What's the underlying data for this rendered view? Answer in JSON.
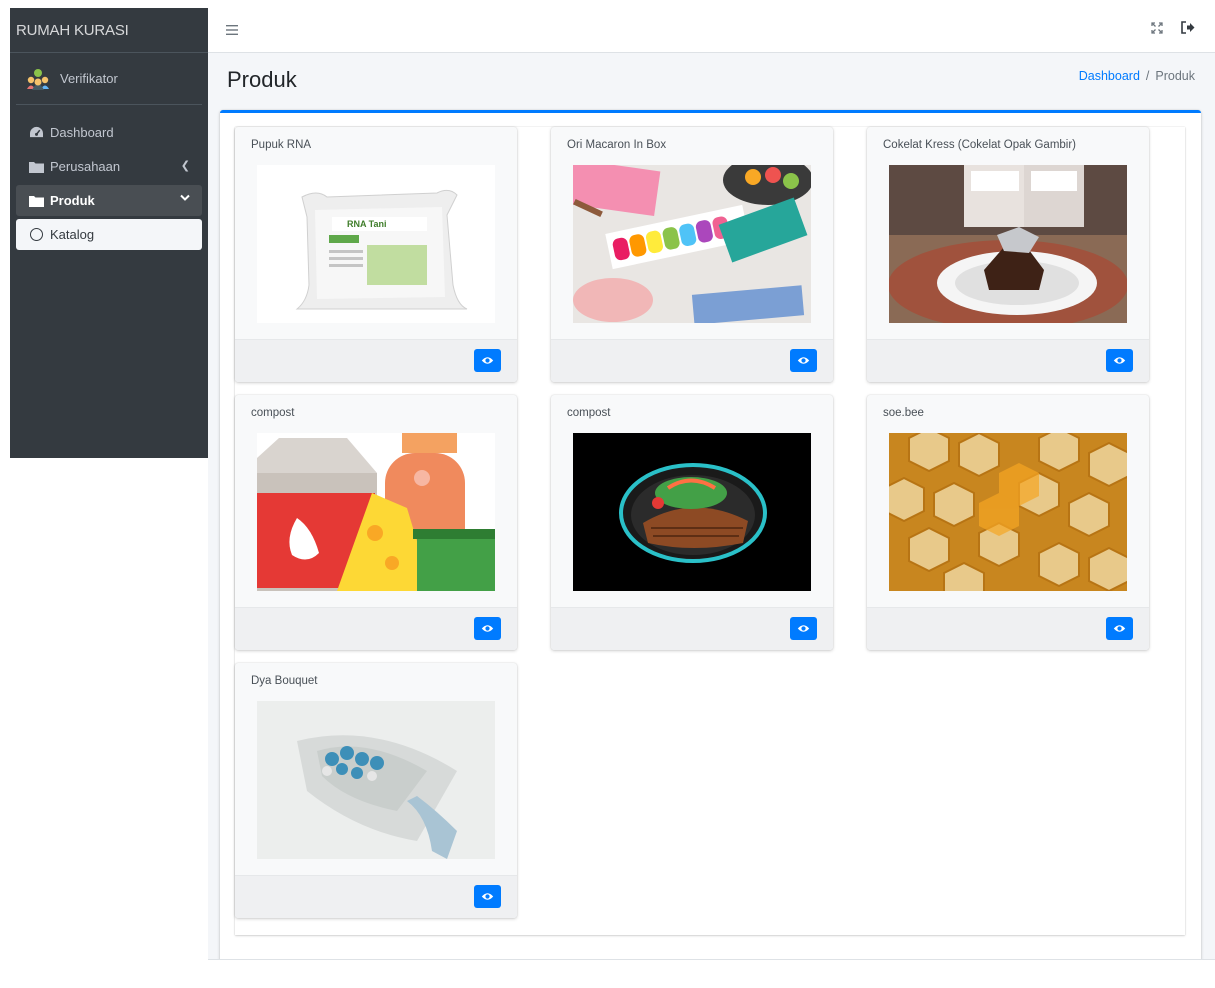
{
  "brand": {
    "name": "RUMAH KURASI"
  },
  "user": {
    "name": "Verifikator",
    "icon": "user-group-avatar-icon"
  },
  "sidebar": {
    "items": [
      {
        "label": "Dashboard",
        "icon": "tachometer-icon"
      },
      {
        "label": "Perusahaan",
        "icon": "folder-icon"
      },
      {
        "label": "Produk",
        "icon": "folder-icon"
      },
      {
        "label": "Katalog",
        "icon": "circle-outline-icon"
      }
    ]
  },
  "navbar": {
    "menu_icon": "hamburger-icon",
    "fullscreen_icon": "expand-icon",
    "logout_icon": "sign-out-icon"
  },
  "page": {
    "title": "Produk"
  },
  "breadcrumb": {
    "home": "Dashboard",
    "separator": "/",
    "current": "Produk"
  },
  "products": [
    {
      "title": "Pupuk RNA",
      "image": "fertilizer-sack",
      "action_icon": "eye-icon"
    },
    {
      "title": "Ori Macaron In Box",
      "image": "macaron-box",
      "action_icon": "eye-icon"
    },
    {
      "title": "Cokelat Kress (Cokelat Opak Gambir)",
      "image": "chocolate-cake",
      "action_icon": "eye-icon"
    },
    {
      "title": "compost",
      "image": "dairy-illustration",
      "action_icon": "eye-icon"
    },
    {
      "title": "compost",
      "image": "grilled-meat-plate",
      "action_icon": "eye-icon"
    },
    {
      "title": "soe.bee",
      "image": "honeycomb-soap",
      "action_icon": "eye-icon"
    },
    {
      "title": "Dya Bouquet",
      "image": "flower-bouquet",
      "action_icon": "eye-icon"
    }
  ],
  "colors": {
    "sidebar_bg": "#343a40",
    "primary": "#007bff",
    "content_bg": "#f4f6f9"
  }
}
